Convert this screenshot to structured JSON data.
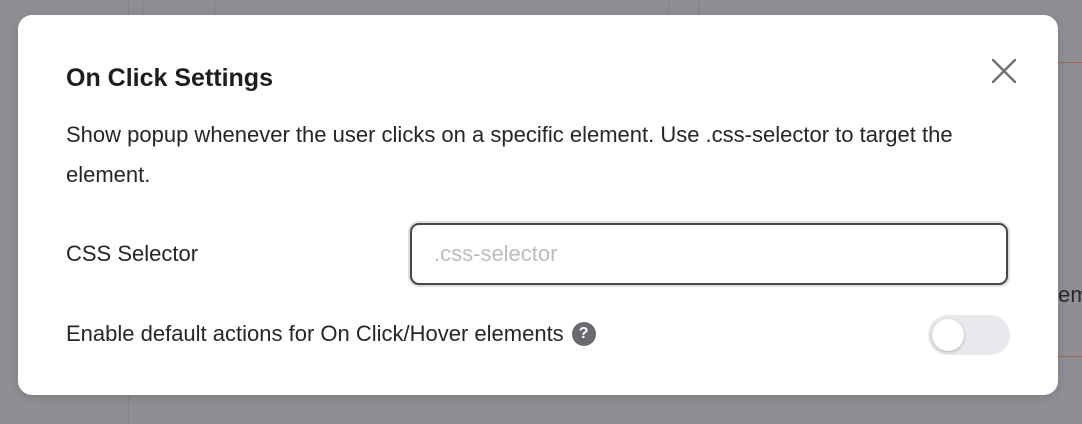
{
  "background": {
    "partial_text": "em"
  },
  "modal": {
    "title": "On Click Settings",
    "description": "Show popup whenever the user clicks on a specific element. Use .css-selector to target the element.",
    "close_icon": "close-icon",
    "css_selector": {
      "label": "CSS Selector",
      "value": "",
      "placeholder": ".css-selector"
    },
    "default_actions": {
      "label": "Enable default actions for On Click/Hover elements",
      "help_icon": "?",
      "enabled": false
    }
  },
  "colors": {
    "overlay": "#8f8e92",
    "modal_bg": "#ffffff",
    "toggle_off": "#e9e8ec",
    "help_icon_bg": "#6b6a70"
  }
}
